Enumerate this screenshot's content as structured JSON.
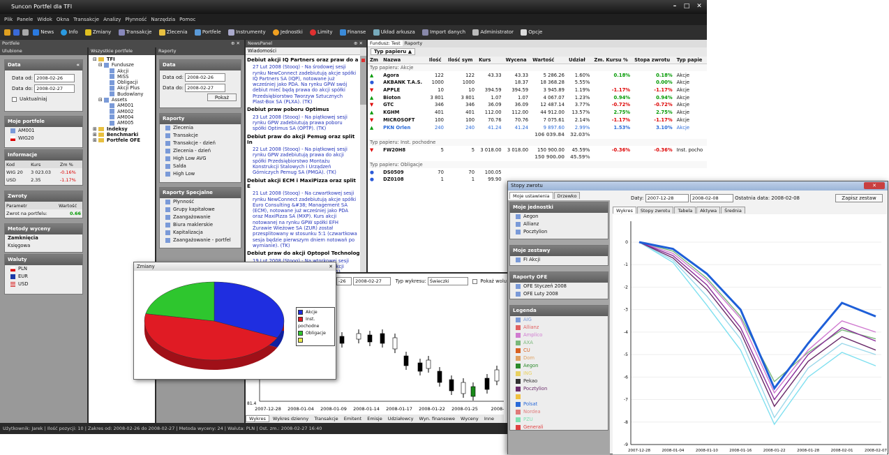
{
  "app": {
    "title": "Suncon Portfel dla TFI",
    "menu": [
      "Plik",
      "Panele",
      "Widok",
      "Okna",
      "Transakcje",
      "Analizy",
      "Płynność",
      "Narzędzia",
      "Pomoc"
    ],
    "toolbar": [
      "News",
      "Info",
      "Zmiany",
      "Transakcje",
      "Zlecenia",
      "Portfele",
      "Instrumenty",
      "Jednostki",
      "Limity",
      "Finanse",
      "Układ arkusza",
      "Import danych",
      "Administrator",
      "Opcje"
    ]
  },
  "portfele": {
    "title": "Portfele",
    "ulubione": "Ulubione",
    "data": {
      "title": "Data",
      "od_label": "Data od:",
      "od": "2008-02-26",
      "do_label": "Data do:",
      "do": "2008-02-27",
      "uaktualniaj": "Uaktualniaj"
    },
    "moje": {
      "title": "Moje portfele",
      "items": [
        "AM001",
        "WIG20"
      ]
    },
    "informacje": {
      "title": "Informacje",
      "headers": [
        "Kod",
        "Kurs",
        "Zm %"
      ],
      "rows": [
        [
          "WIG 20",
          "3 023.03",
          "-0.16%"
        ],
        [
          "USD",
          "2.35",
          "-1.17%"
        ]
      ]
    },
    "zwroty": {
      "title": "Zwroty",
      "headers": [
        "Parametr",
        "Wartość"
      ],
      "row": [
        "Zwrot na portfelu:",
        "0.66"
      ]
    },
    "metody": {
      "title": "Metody wyceny",
      "bold": "Zamknięcia",
      "sub": "Księgowa"
    },
    "waluty": {
      "title": "Waluty",
      "items": [
        "PLN",
        "EUR",
        "USD"
      ]
    }
  },
  "wszystkie": {
    "title": "Wszystkie portfele",
    "tree": [
      "TFI",
      "Fundusze",
      "Akcji",
      "MiŚS",
      "Obligacji",
      "Akcji Plus",
      "Budowlany",
      "Assets",
      "AM001",
      "AM002",
      "AM004",
      "AM005",
      "Indeksy",
      "Benchmarki",
      "Portfele OFE"
    ]
  },
  "raporty": {
    "title": "Raporty",
    "data_title": "Data",
    "od_label": "Data od:",
    "od": "2008-02-26",
    "do_label": "Data do:",
    "do": "2008-02-27",
    "pokaz": "Pokaż",
    "raporty_title": "Raporty",
    "raporty_items": [
      "Zlecenia",
      "Transakcje",
      "Transakcje - dzień",
      "Zlecenia - dzień",
      "High Low AVG",
      "Salda",
      "High Low"
    ],
    "spec_title": "Raporty Specjalne",
    "spec_items": [
      "Płynność",
      "Grupy kapitałowe",
      "Zaangażowanie",
      "Biura maklerskie",
      "Kapitalizacja",
      "Zaangażowanie - portfel"
    ]
  },
  "news": {
    "panel": "NewsPanel",
    "header": "Wiadomości",
    "items": [
      {
        "h": "Debiut akcji IQ Partners oraz praw do a",
        "t": "27 Lut 2008 (Stooq) - Na środowej sesji rynku NewConnect zadebiutują akcje spółki IQ Partners SA (IQP), notowane już wcześniej jako PDA. Na rynku GPW swój debiut mieć będą prawa do akcji spółki Przedsiębiorstwo Tworzyw Sztucznych Plast-Box SA (PLXA). (TK)"
      },
      {
        "h": "Debiut praw poboru Optimus",
        "t": "23 Lut 2008 (Stooq) - Na piątkowej sesji rynku GPW zadebiutują prawa poboru spółki Optimus SA (OPTP). (TK)"
      },
      {
        "h": "Debiut praw do akcji Pemug oraz split In",
        "t": "22 Lut 2008 (Stooq) - Na piątkowej sesji rynku GPW zadebiutują prawa do akcji spółki Przedsiębiorstwo Montażu Konstrukcji Stalowych i Urządzeń Górniczych Pemug SA (PMGA). (TK)"
      },
      {
        "h": "Debiut akcji ECM i MaxiPizza oraz split E",
        "t": "21 Lut 2008 (Stooq) - Na czwartkowej sesji rynku NewConnect zadebiutują akcje spółki Euro Consulting &#38; Management SA (ECM), notowane już wcześniej jako PDA oraz MaxiPizza SA (MXP). Kurs akcji notowanej na rynku GPW spółki EFH Żurawie Wieżowe SA (ZUR) został przesplitowany w stosunku 5:1 (czwartkowa sesja będzie pierwszym dniem notowań po wymianie). (TK)"
      },
      {
        "h": "Debiut praw do akcji Optopol Technolog",
        "t": "19 Lut 2008 (Stooq) - Na wtorkowej sesji rynku GPW zadebiutują prawa do akcji spółki Optopol Technology SA (OPLA)."
      }
    ]
  },
  "fundusz": {
    "tabs": [
      "Fundusz: Test",
      "Raporty"
    ],
    "typ_papieru": "Typ papieru",
    "headers": [
      "Zm",
      "Nazwa",
      "Ilość",
      "Ilość sym",
      "Kurs",
      "Wycena",
      "Wartość",
      "Udział",
      "Zm. Kursu %",
      "Stopa zwrotu",
      "Typ papie"
    ],
    "groups": [
      {
        "label": "Typ papieru: Akcje",
        "rows": [
          [
            "Agora",
            "122",
            "122",
            "43.33",
            "43.33",
            "5 286.26",
            "1.60%",
            "0.18%",
            "0.18%",
            "Akcje"
          ],
          [
            "AKBANK T.A.S.",
            "1000",
            "1000",
            "",
            "18.37",
            "18 368.28",
            "5.55%",
            "",
            "0.00%",
            "Akcje"
          ],
          [
            "APPLE",
            "10",
            "10",
            "394.59",
            "394.59",
            "3 945.89",
            "1.19%",
            "-1.17%",
            "-1.17%",
            "Akcje"
          ],
          [
            "Bioton",
            "3 801",
            "3 801",
            "1.07",
            "1.07",
            "4 067.07",
            "1.23%",
            "0.94%",
            "0.94%",
            "Akcje"
          ],
          [
            "GTC",
            "346",
            "346",
            "36.09",
            "36.09",
            "12 487.14",
            "3.77%",
            "-0.72%",
            "-0.72%",
            "Akcje"
          ],
          [
            "KGHM",
            "401",
            "401",
            "112.00",
            "112.00",
            "44 912.00",
            "13.57%",
            "2.75%",
            "2.75%",
            "Akcje"
          ],
          [
            "MICROSOFT",
            "100",
            "100",
            "70.76",
            "70.76",
            "7 075.61",
            "2.14%",
            "-1.17%",
            "-1.17%",
            "Akcje"
          ],
          [
            "PKN Orlen",
            "240",
            "240",
            "41.24",
            "41.24",
            "9 897.60",
            "2.99%",
            "1.53%",
            "3.10%",
            "Akcje"
          ]
        ],
        "sum": [
          "106 039.84",
          "32.03%"
        ]
      },
      {
        "label": "Typ papieru: Inst. pochodne",
        "rows": [
          [
            "FW20H8",
            "5",
            "5",
            "3 018.00",
            "3 018.00",
            "150 900.00",
            "45.59%",
            "-0.36%",
            "-0.36%",
            "Inst. pocho"
          ]
        ],
        "sum": [
          "150 900.00",
          "45.59%"
        ]
      },
      {
        "label": "Typ papieru: Obligacje",
        "rows": [
          [
            "DS0509",
            "70",
            "70",
            "100.05",
            "",
            "",
            "",
            "",
            "",
            ""
          ],
          [
            "DZ0108",
            "1",
            "1",
            "99.90",
            "",
            "",
            "",
            "",
            "",
            ""
          ]
        ]
      }
    ]
  },
  "wykres": {
    "date_from": "-26",
    "date_to": "2008-02-27",
    "typ_label": "Typ wykresu:",
    "typ": "Świeczki",
    "pokaz": "Pokaż wolu",
    "ymin": "81.4",
    "xticks": [
      "2007-12-28",
      "2008-01-04",
      "2008-01-09",
      "2008-01-14",
      "2008-01-17",
      "2008-01-22",
      "2008-01-25",
      "2008-"
    ],
    "tabs": [
      "Wykres",
      "Wykres dzienny",
      "Transakcje",
      "Emitent",
      "Emisje",
      "Udziałowcy",
      "Wyn. finansowe",
      "Wyceny",
      "Inne"
    ]
  },
  "zmiany": {
    "title": "Zmiany",
    "legend": [
      "Akcje",
      "Inst. pochodne",
      "Obligacje",
      ""
    ],
    "colors": [
      "#1f2ee0",
      "#e01b24",
      "#2ec62e",
      "#e8e84a"
    ]
  },
  "status": [
    "Użytkownik: Jarek",
    "Ilość pozycji: 10",
    "Zakres od: 2008-02-26 do 2008-02-27",
    "Metoda wyceny: 24",
    "Waluta: PLN",
    "Ost. zm.: 2008-02-27 16:40"
  ],
  "stopy": {
    "title": "Stopy zwrotu",
    "tabs": [
      "Moje ustawienia",
      "Drzewko"
    ],
    "daty_label": "Daty:",
    "od": "2007-12-28",
    "do": "2008-02-08",
    "ostatnia": "Ostatnia data: 2008-02-08",
    "zapisz": "Zapisz zestaw",
    "chart_tabs": [
      "Wykres",
      "Stopy zwrotu",
      "Tabela",
      "Aktywa",
      "Średnia"
    ],
    "moje_jednostki": {
      "title": "Moje jednostki",
      "items": [
        "Aegon",
        "Allianz",
        "Pocztylion"
      ]
    },
    "moje_zestawy": {
      "title": "Moje zestawy",
      "items": [
        "FI Akcji"
      ]
    },
    "raporty_ofe": {
      "title": "Raporty OFE",
      "items": [
        "OFE Styczeń 2008",
        "OFE Luty 2008"
      ]
    },
    "legenda": {
      "title": "Legenda",
      "items": [
        "AIG",
        "Allianz",
        "Amplico",
        "AXA",
        "CU",
        "Dom",
        "Aegon",
        "ING",
        "Pekao",
        "Pocztylion",
        "",
        "Polsat",
        "Nordea",
        "PZU",
        "Generali"
      ]
    }
  },
  "chart_data": {
    "type": "line",
    "title": "",
    "xlabel": "",
    "ylabel": "",
    "ylim": [
      -9,
      0
    ],
    "yticks": [
      "0",
      "-1",
      "-2",
      "-3",
      "-4",
      "-5",
      "-6",
      "-7",
      "-8",
      "-9"
    ],
    "x": [
      "2007-12-28",
      "2008-01-04",
      "2008-01-10",
      "2008-01-16",
      "2008-01-22",
      "2008-01-28",
      "2008-02-01",
      "2008-02-07"
    ],
    "series": [
      {
        "values": [
          0,
          -0.3,
          -1.4,
          -3.0,
          -6.5,
          -4.5,
          -2.7,
          -3.3
        ],
        "color": "#1e5fd8"
      },
      {
        "values": [
          0,
          -0.6,
          -1.9,
          -3.8,
          -7.0,
          -5.0,
          -3.8,
          -4.4
        ],
        "color": "#8a2c9a"
      },
      {
        "values": [
          0,
          -0.7,
          -2.1,
          -4.0,
          -7.3,
          -5.3,
          -4.2,
          -4.8
        ],
        "color": "#6a2b6a"
      },
      {
        "values": [
          0,
          -0.5,
          -1.7,
          -3.4,
          -6.7,
          -4.8,
          -3.5,
          -4.0
        ],
        "color": "#d07ad0"
      },
      {
        "values": [
          0,
          -0.8,
          -2.4,
          -4.3,
          -7.8,
          -5.6,
          -4.5,
          -5.0
        ],
        "color": "#9bd8ea"
      },
      {
        "values": [
          0,
          -0.4,
          -1.6,
          -3.3,
          -6.2,
          -4.9,
          -3.9,
          -4.3
        ],
        "color": "#7ab87a"
      },
      {
        "values": [
          0,
          -0.9,
          -2.8,
          -4.8,
          -8.1,
          -6.0,
          -4.9,
          -5.5
        ],
        "color": "#7fe0f0"
      }
    ]
  }
}
